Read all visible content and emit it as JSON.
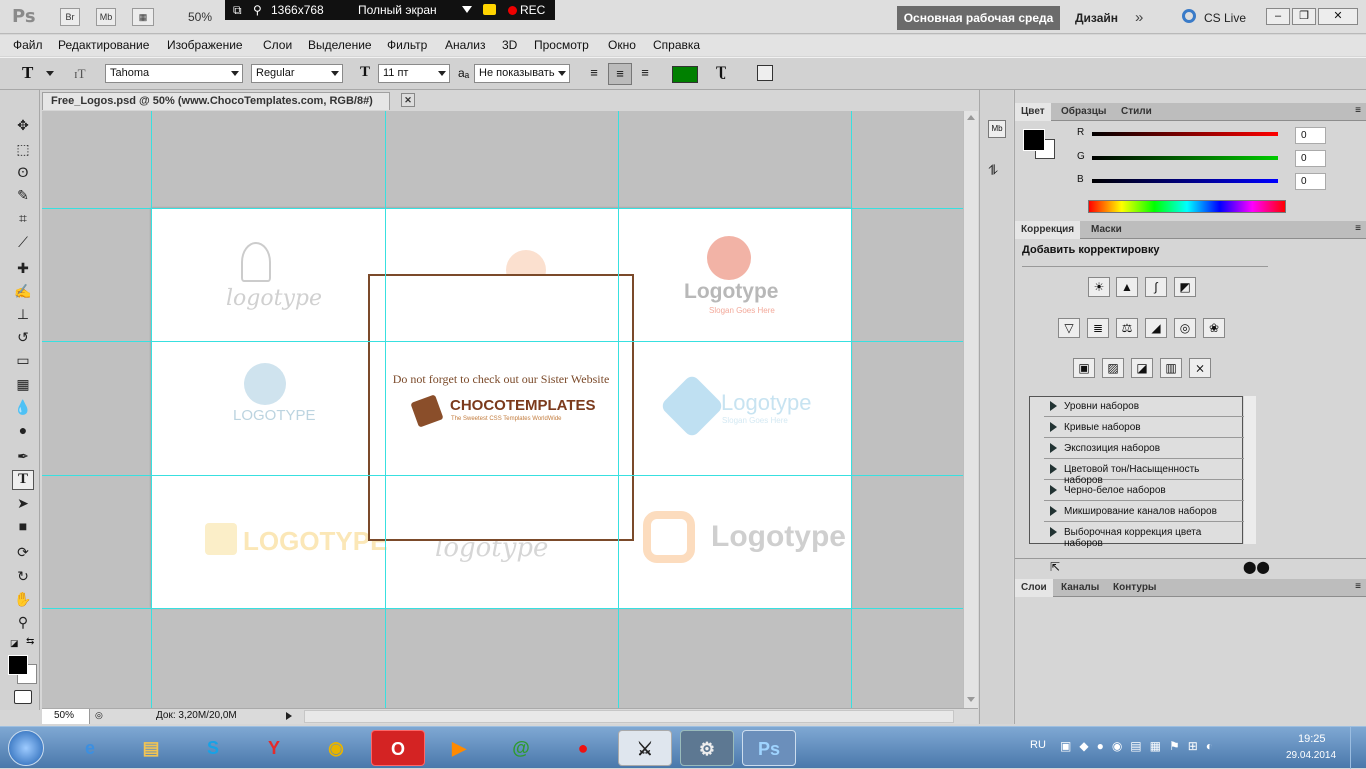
{
  "app": {
    "logo": "Ps",
    "bridge": "Br",
    "minibridge": "Mb",
    "zoom": "50%",
    "workspace": "Основная рабочая среда",
    "design": "Дизайн",
    "cslive": "CS Live"
  },
  "recorder": {
    "resolution": "1366x768",
    "mode": "Полный экран",
    "rec": "REC"
  },
  "menu": [
    "Файл",
    "Редактирование",
    "Изображение",
    "Слои",
    "Выделение",
    "Фильтр",
    "Анализ",
    "3D",
    "Просмотр",
    "Окно",
    "Справка"
  ],
  "options": {
    "font_family": "Tahoma",
    "font_style": "Regular",
    "font_size": "11 пт",
    "antialias": "Не показывать",
    "color": "#008000"
  },
  "document": {
    "tab": "Free_Logos.psd @ 50% (www.ChocoTemplates.com, RGB/8#)",
    "logos": [
      "logotype",
      "LOGOTYPE",
      "Logotype",
      "LOGOTYPE",
      "Logotype",
      "Logotype",
      "logotype",
      "Logotype"
    ],
    "slogans": [
      "Slogan Goes Here",
      "Slogan Goes Here"
    ],
    "promo_text": "Do not forget to check out our Sister Website",
    "promo_brand": "CHOCOTEMPLATES",
    "promo_tagline": "The Sweetest CSS Templates WorldWide"
  },
  "status": {
    "zoom": "50%",
    "doc": "Док: 3,20M/20,0M"
  },
  "panels": {
    "color_tabs": [
      "Цвет",
      "Образцы",
      "Стили"
    ],
    "r_label": "R",
    "g_label": "G",
    "b_label": "B",
    "r": "0",
    "g": "0",
    "b": "0",
    "adj_tabs": [
      "Коррекция",
      "Маски"
    ],
    "add_adjustment": "Добавить корректировку",
    "presets": [
      "Уровни наборов",
      "Кривые наборов",
      "Экспозиция наборов",
      "Цветовой тон/Насыщенность наборов",
      "Черно-белое наборов",
      "Микширование каналов наборов",
      "Выборочная коррекция цвета наборов"
    ],
    "layer_tabs": [
      "Слои",
      "Каналы",
      "Контуры"
    ]
  },
  "taskbar": {
    "lang": "RU",
    "time": "19:25",
    "date": "29.04.2014"
  }
}
